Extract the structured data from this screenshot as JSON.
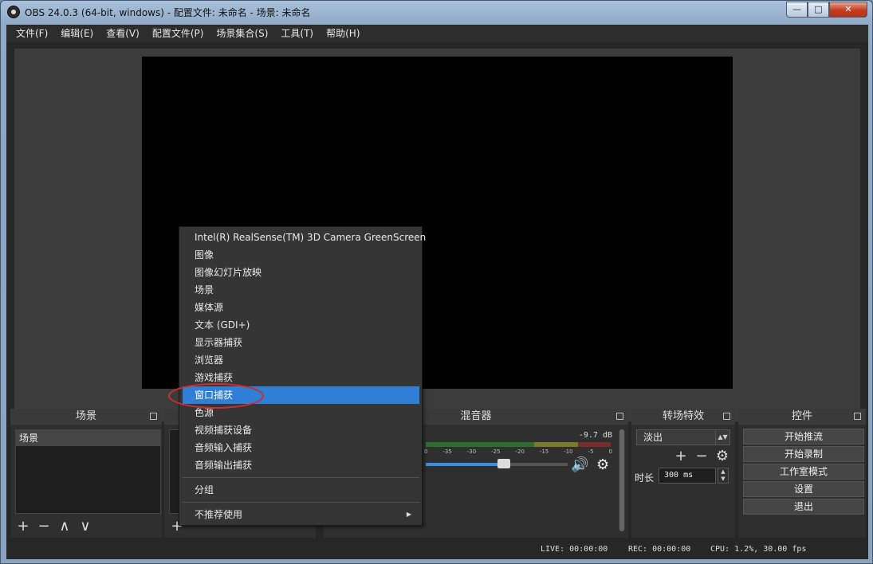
{
  "window": {
    "title": "OBS 24.0.3 (64-bit, windows) - 配置文件: 未命名 - 场景: 未命名",
    "minimize_glyph": "—",
    "maximize_glyph": "□",
    "close_glyph": "✕"
  },
  "menubar": {
    "items": [
      "文件(F)",
      "编辑(E)",
      "查看(V)",
      "配置文件(P)",
      "场景集合(S)",
      "工具(T)",
      "帮助(H)"
    ]
  },
  "scenes_dock": {
    "title": "场景",
    "items": [
      "场景"
    ]
  },
  "mixer_dock": {
    "title": "混音器",
    "db_value": "-9.7 dB",
    "tick_labels": [
      "0",
      "-35",
      "-30",
      "-25",
      "-20",
      "-15",
      "-10",
      "-5",
      "0"
    ],
    "volume_fraction": 0.55
  },
  "transitions_dock": {
    "title": "转场特效",
    "selected_transition": "淡出",
    "duration_label": "时长",
    "duration_value": "300 ms"
  },
  "controls_dock": {
    "title": "控件",
    "buttons": [
      "开始推流",
      "开始录制",
      "工作室模式",
      "设置",
      "退出"
    ]
  },
  "statusbar": {
    "live": "LIVE: 00:00:00",
    "rec": "REC: 00:00:00",
    "cpu": "CPU: 1.2%, 30.00 fps"
  },
  "context_menu": {
    "items": [
      "Intel(R) RealSense(TM) 3D Camera GreenScreen",
      "图像",
      "图像幻灯片放映",
      "场景",
      "媒体源",
      "文本 (GDI+)",
      "显示器捕获",
      "浏览器",
      "游戏捕获",
      "窗口捕获",
      "色源",
      "视频捕获设备",
      "音频输入捕获",
      "音频输出捕获"
    ],
    "selected_index": 9,
    "group_label": "分组",
    "deprecated_label": "不推荐使用"
  },
  "icons": {
    "add": "+",
    "remove": "−",
    "up": "∧",
    "down": "∨",
    "speaker": "🔊",
    "gear": "⚙",
    "submenu_arrow": "▶"
  },
  "colors": {
    "selection": "#2f7fd6",
    "annotation": "#d42a2a",
    "fader": "#3a8ee6"
  }
}
